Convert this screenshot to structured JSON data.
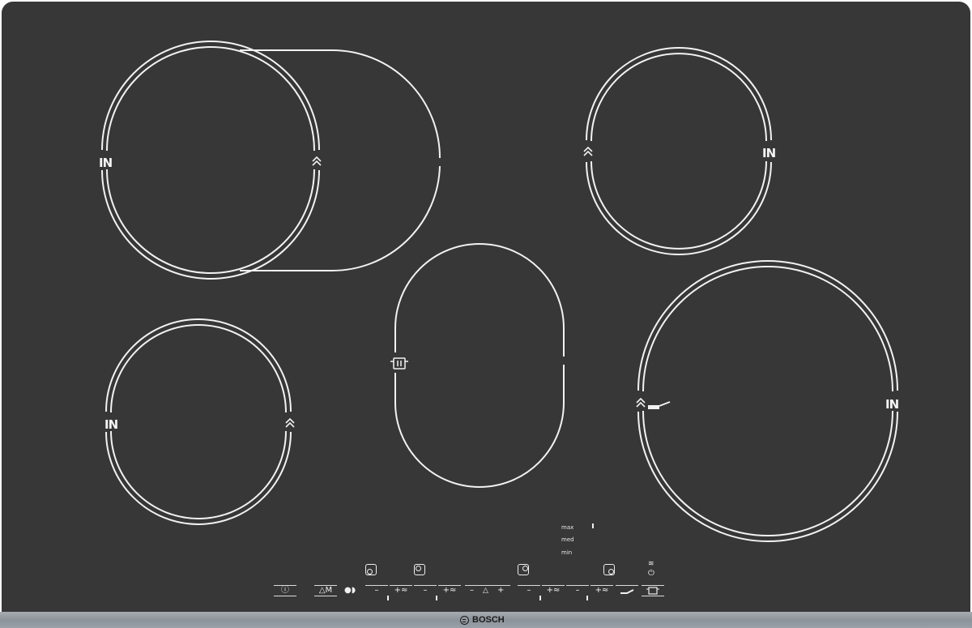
{
  "appliance": {
    "brand": "BOSCH",
    "glass_color": "#373737",
    "line_color": "#f2f2f2",
    "trim_color": "#9aa0a7"
  },
  "zones": {
    "front_left_label_in": "IN",
    "rear_right_label_in": "IN",
    "front_left_small_label_in": "IN",
    "right_large_label_in": "IN"
  },
  "level_scale": {
    "max": "max",
    "med": "med",
    "min": "min"
  },
  "controls": {
    "power": "ⓘ",
    "memory": "△M",
    "child_lock": "●◗",
    "minus": "–",
    "plus_boost": "+≈",
    "plus": "+",
    "timer_bell": "🔔"
  },
  "icons": {
    "power": "power-icon",
    "memory": "memory-icon",
    "lock": "child-lock-icon",
    "boost": "boost-chevron-icon",
    "pot": "pot-icon",
    "pan": "frying-pan-icon",
    "keep_warm": "keep-warm-icon",
    "bell": "timer-bell-icon"
  }
}
